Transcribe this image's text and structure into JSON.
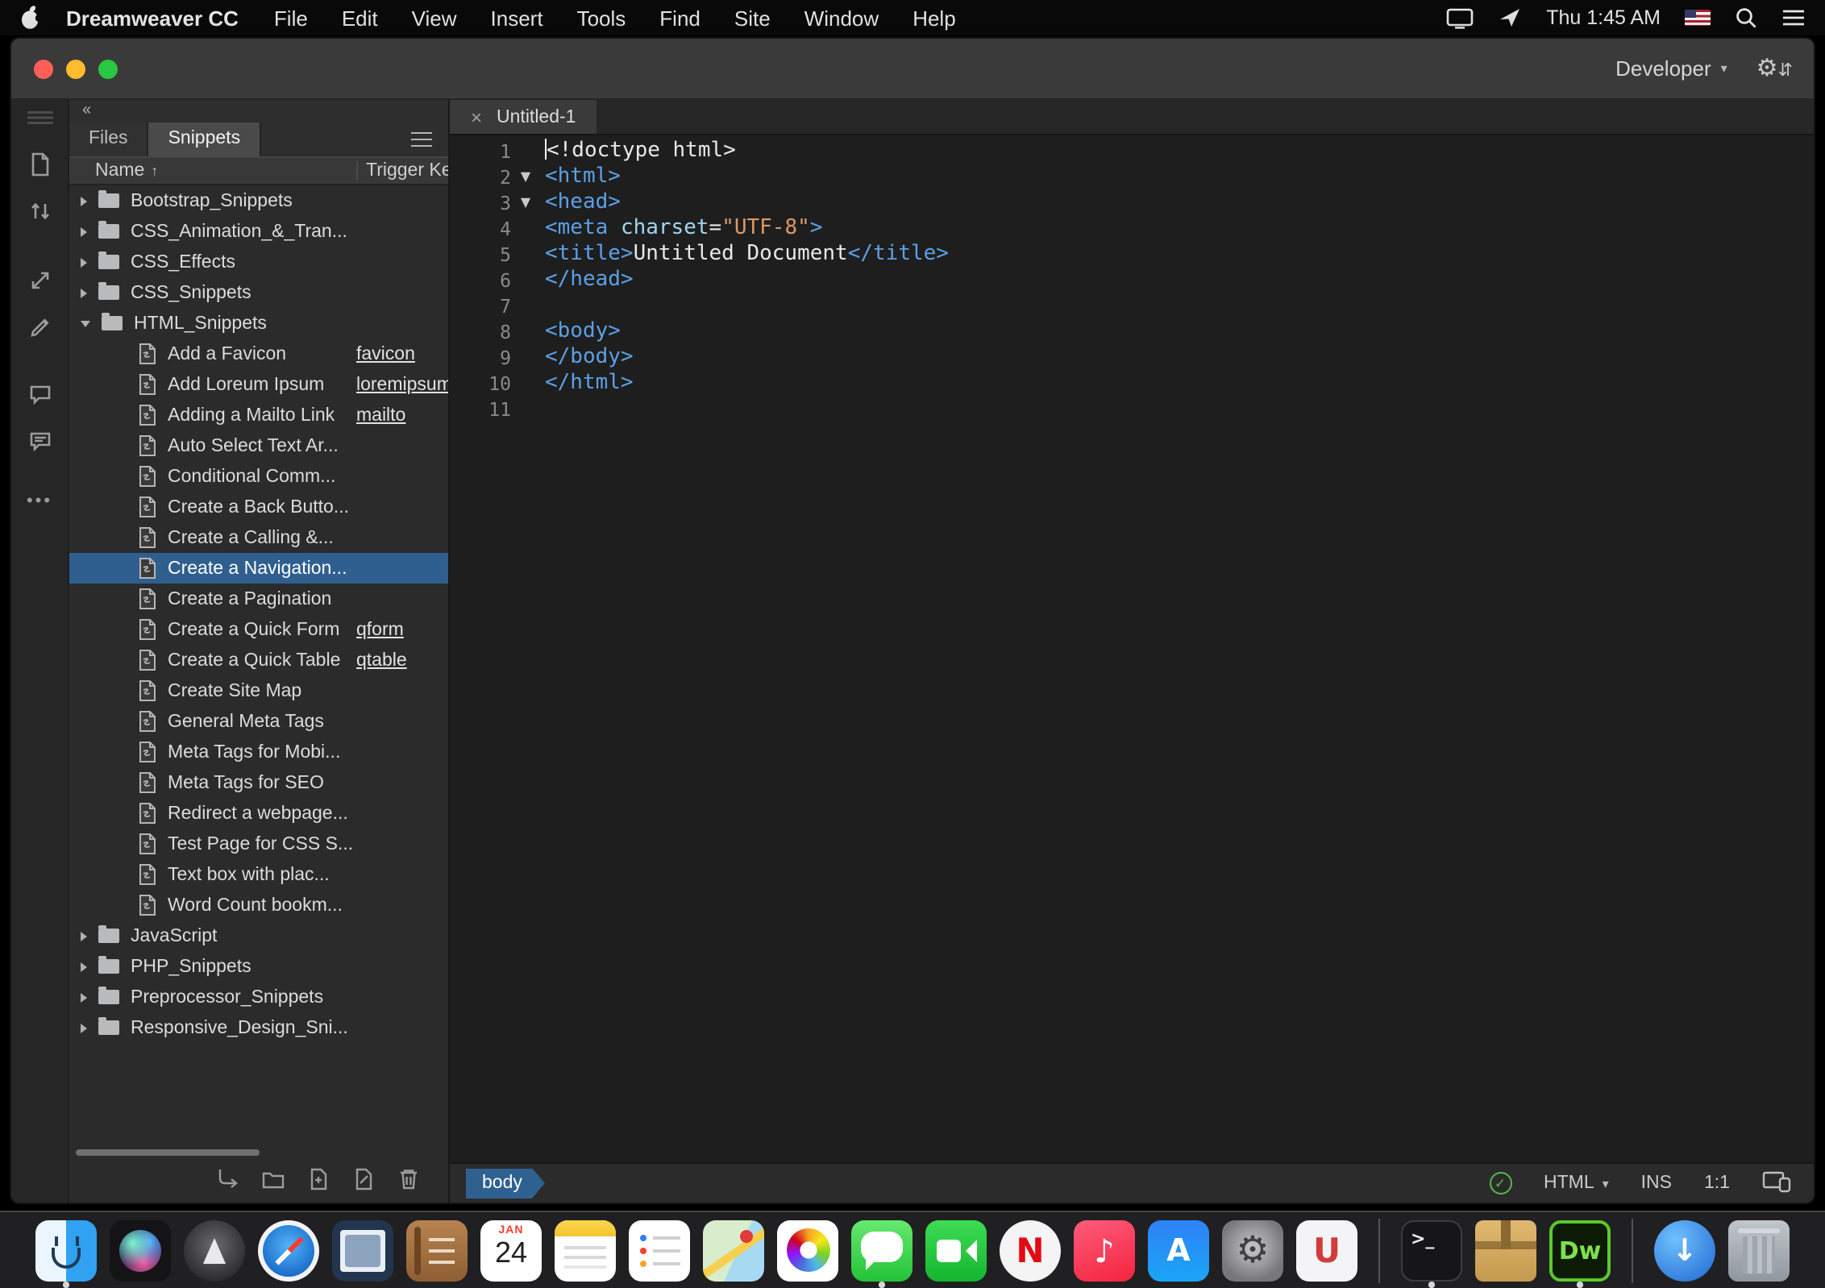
{
  "colors": {
    "menubar-bg": "#0a0a0a",
    "titlebar-bg": "#3a3a3a",
    "chrome-bg": "#2b2b2b",
    "rail-bg": "#262626",
    "editor-bg": "#1e1e1e",
    "selection-blue": "#2f5f8f",
    "tag-blue": "#5ba0e6",
    "attr-cyan": "#9fd6f0",
    "string-orange": "#dd9966",
    "code-plain": "#e8e8e8",
    "traffic-red": "#ff5f57",
    "traffic-yellow": "#febc2e",
    "traffic-green": "#28c840",
    "status-green": "#58b947",
    "badge-blue": "#2f6190"
  },
  "menubar": {
    "app_name": "Dreamweaver CC",
    "menus": [
      "File",
      "Edit",
      "View",
      "Insert",
      "Tools",
      "Find",
      "Site",
      "Window",
      "Help"
    ],
    "clock": "Thu 1:45 AM",
    "icons": [
      "apple-logo-icon",
      "display-icon",
      "screen-share-icon",
      "keyboard-flag-icon",
      "search-icon",
      "notification-list-icon"
    ]
  },
  "window": {
    "workspace": "Developer",
    "document_tab": "Untitled-1",
    "titlebar_icons": [
      "settings-gear-icon",
      "sync-arrows-icon"
    ]
  },
  "rail": {
    "icons": [
      "page-icon",
      "sort-arrows-icon",
      "transfer-arrows-icon",
      "edit-pencil-icon",
      "comment-bubble-icon",
      "comment-lines-icon",
      "more-options-icon"
    ]
  },
  "panel": {
    "tabs": [
      {
        "label": "Files",
        "active": false
      },
      {
        "label": "Snippets",
        "active": true
      }
    ],
    "columns": {
      "name": "Name",
      "sort": "↑",
      "trigger": "Trigger Key"
    },
    "action_icons": [
      "insert-snippet-icon",
      "new-folder-icon",
      "new-snippet-icon",
      "edit-snippet-icon",
      "delete-icon"
    ],
    "tree": [
      {
        "kind": "folder",
        "label": "Bootstrap_Snippets"
      },
      {
        "kind": "folder",
        "label": "CSS_Animation_&_Tran..."
      },
      {
        "kind": "folder",
        "label": "CSS_Effects"
      },
      {
        "kind": "folder",
        "label": "CSS_Snippets"
      },
      {
        "kind": "folder",
        "label": "HTML_Snippets",
        "expanded": true
      },
      {
        "kind": "snippet",
        "label": "Add a Favicon",
        "trigger": "favicon"
      },
      {
        "kind": "snippet",
        "label": "Add Loreum Ipsum",
        "trigger": "loremipsum"
      },
      {
        "kind": "snippet",
        "label": "Adding a Mailto Link",
        "trigger": "mailto"
      },
      {
        "kind": "snippet",
        "label": "Auto Select Text Ar..."
      },
      {
        "kind": "snippet",
        "label": "Conditional Comm..."
      },
      {
        "kind": "snippet",
        "label": "Create a Back Butto..."
      },
      {
        "kind": "snippet",
        "label": "Create a Calling &..."
      },
      {
        "kind": "snippet",
        "label": "Create a Navigation...",
        "selected": true
      },
      {
        "kind": "snippet",
        "label": "Create a Pagination"
      },
      {
        "kind": "snippet",
        "label": "Create a Quick Form",
        "trigger": "qform"
      },
      {
        "kind": "snippet",
        "label": "Create a Quick Table",
        "trigger": "qtable"
      },
      {
        "kind": "snippet",
        "label": "Create Site Map"
      },
      {
        "kind": "snippet",
        "label": "General Meta Tags"
      },
      {
        "kind": "snippet",
        "label": "Meta Tags for Mobi..."
      },
      {
        "kind": "snippet",
        "label": "Meta Tags for SEO"
      },
      {
        "kind": "snippet",
        "label": "Redirect a webpage..."
      },
      {
        "kind": "snippet",
        "label": "Test Page for CSS S..."
      },
      {
        "kind": "snippet",
        "label": "Text box with plac..."
      },
      {
        "kind": "snippet",
        "label": "Word Count bookm..."
      },
      {
        "kind": "folder",
        "label": "JavaScript"
      },
      {
        "kind": "folder",
        "label": "PHP_Snippets"
      },
      {
        "kind": "folder",
        "label": "Preprocessor_Snippets"
      },
      {
        "kind": "folder",
        "label": "Responsive_Design_Sni..."
      }
    ]
  },
  "editor": {
    "lines": [
      {
        "n": 1,
        "cursor": true,
        "seg": [
          [
            "plain",
            "<!doctype html>"
          ]
        ]
      },
      {
        "n": 2,
        "fold": true,
        "seg": [
          [
            "tag",
            "<html>"
          ]
        ]
      },
      {
        "n": 3,
        "fold": true,
        "seg": [
          [
            "tag",
            "<head>"
          ]
        ]
      },
      {
        "n": 4,
        "seg": [
          [
            "tag",
            "<meta "
          ],
          [
            "attr",
            "charset"
          ],
          [
            "plain",
            "="
          ],
          [
            "str",
            "\"UTF-8\""
          ],
          [
            "tag",
            ">"
          ]
        ]
      },
      {
        "n": 5,
        "seg": [
          [
            "tag",
            "<title>"
          ],
          [
            "plain",
            "Untitled Document"
          ],
          [
            "tag",
            "</title>"
          ]
        ]
      },
      {
        "n": 6,
        "seg": [
          [
            "tag",
            "</head>"
          ]
        ]
      },
      {
        "n": 7,
        "seg": []
      },
      {
        "n": 8,
        "seg": [
          [
            "tag",
            "<body>"
          ]
        ]
      },
      {
        "n": 9,
        "seg": [
          [
            "tag",
            "</body>"
          ]
        ]
      },
      {
        "n": 10,
        "seg": [
          [
            "tag",
            "</html>"
          ]
        ]
      },
      {
        "n": 11,
        "seg": []
      }
    ]
  },
  "statusbar": {
    "tag_selector": "body",
    "doc_type": "HTML",
    "insert_mode": "INS",
    "cursor_position": "1:1",
    "icons": [
      "lint-ok-icon",
      "doctype-dropdown-icon",
      "preview-devices-icon"
    ]
  },
  "dock": {
    "items": [
      {
        "name": "finder",
        "running": true
      },
      {
        "name": "siri"
      },
      {
        "name": "launchpad"
      },
      {
        "name": "safari"
      },
      {
        "name": "mail"
      },
      {
        "name": "contacts"
      },
      {
        "name": "calendar",
        "line1": "JAN",
        "line2": "24"
      },
      {
        "name": "notes"
      },
      {
        "name": "reminders"
      },
      {
        "name": "maps"
      },
      {
        "name": "photos"
      },
      {
        "name": "messages",
        "running": true
      },
      {
        "name": "facetime"
      },
      {
        "name": "netflix",
        "glyph": "N"
      },
      {
        "name": "music",
        "glyph": "♪"
      },
      {
        "name": "appstore",
        "glyph": "A"
      },
      {
        "name": "system-preferences",
        "glyph": "⚙"
      },
      {
        "name": "magnet",
        "glyph": "U"
      },
      {
        "name": "terminal",
        "glyph": ">_",
        "running": true,
        "sep_before": true
      },
      {
        "name": "archive"
      },
      {
        "name": "dreamweaver",
        "glyph": "Dw",
        "running": true
      },
      {
        "name": "downloads",
        "glyph": "↓",
        "sep_before": true
      },
      {
        "name": "trash"
      }
    ]
  }
}
